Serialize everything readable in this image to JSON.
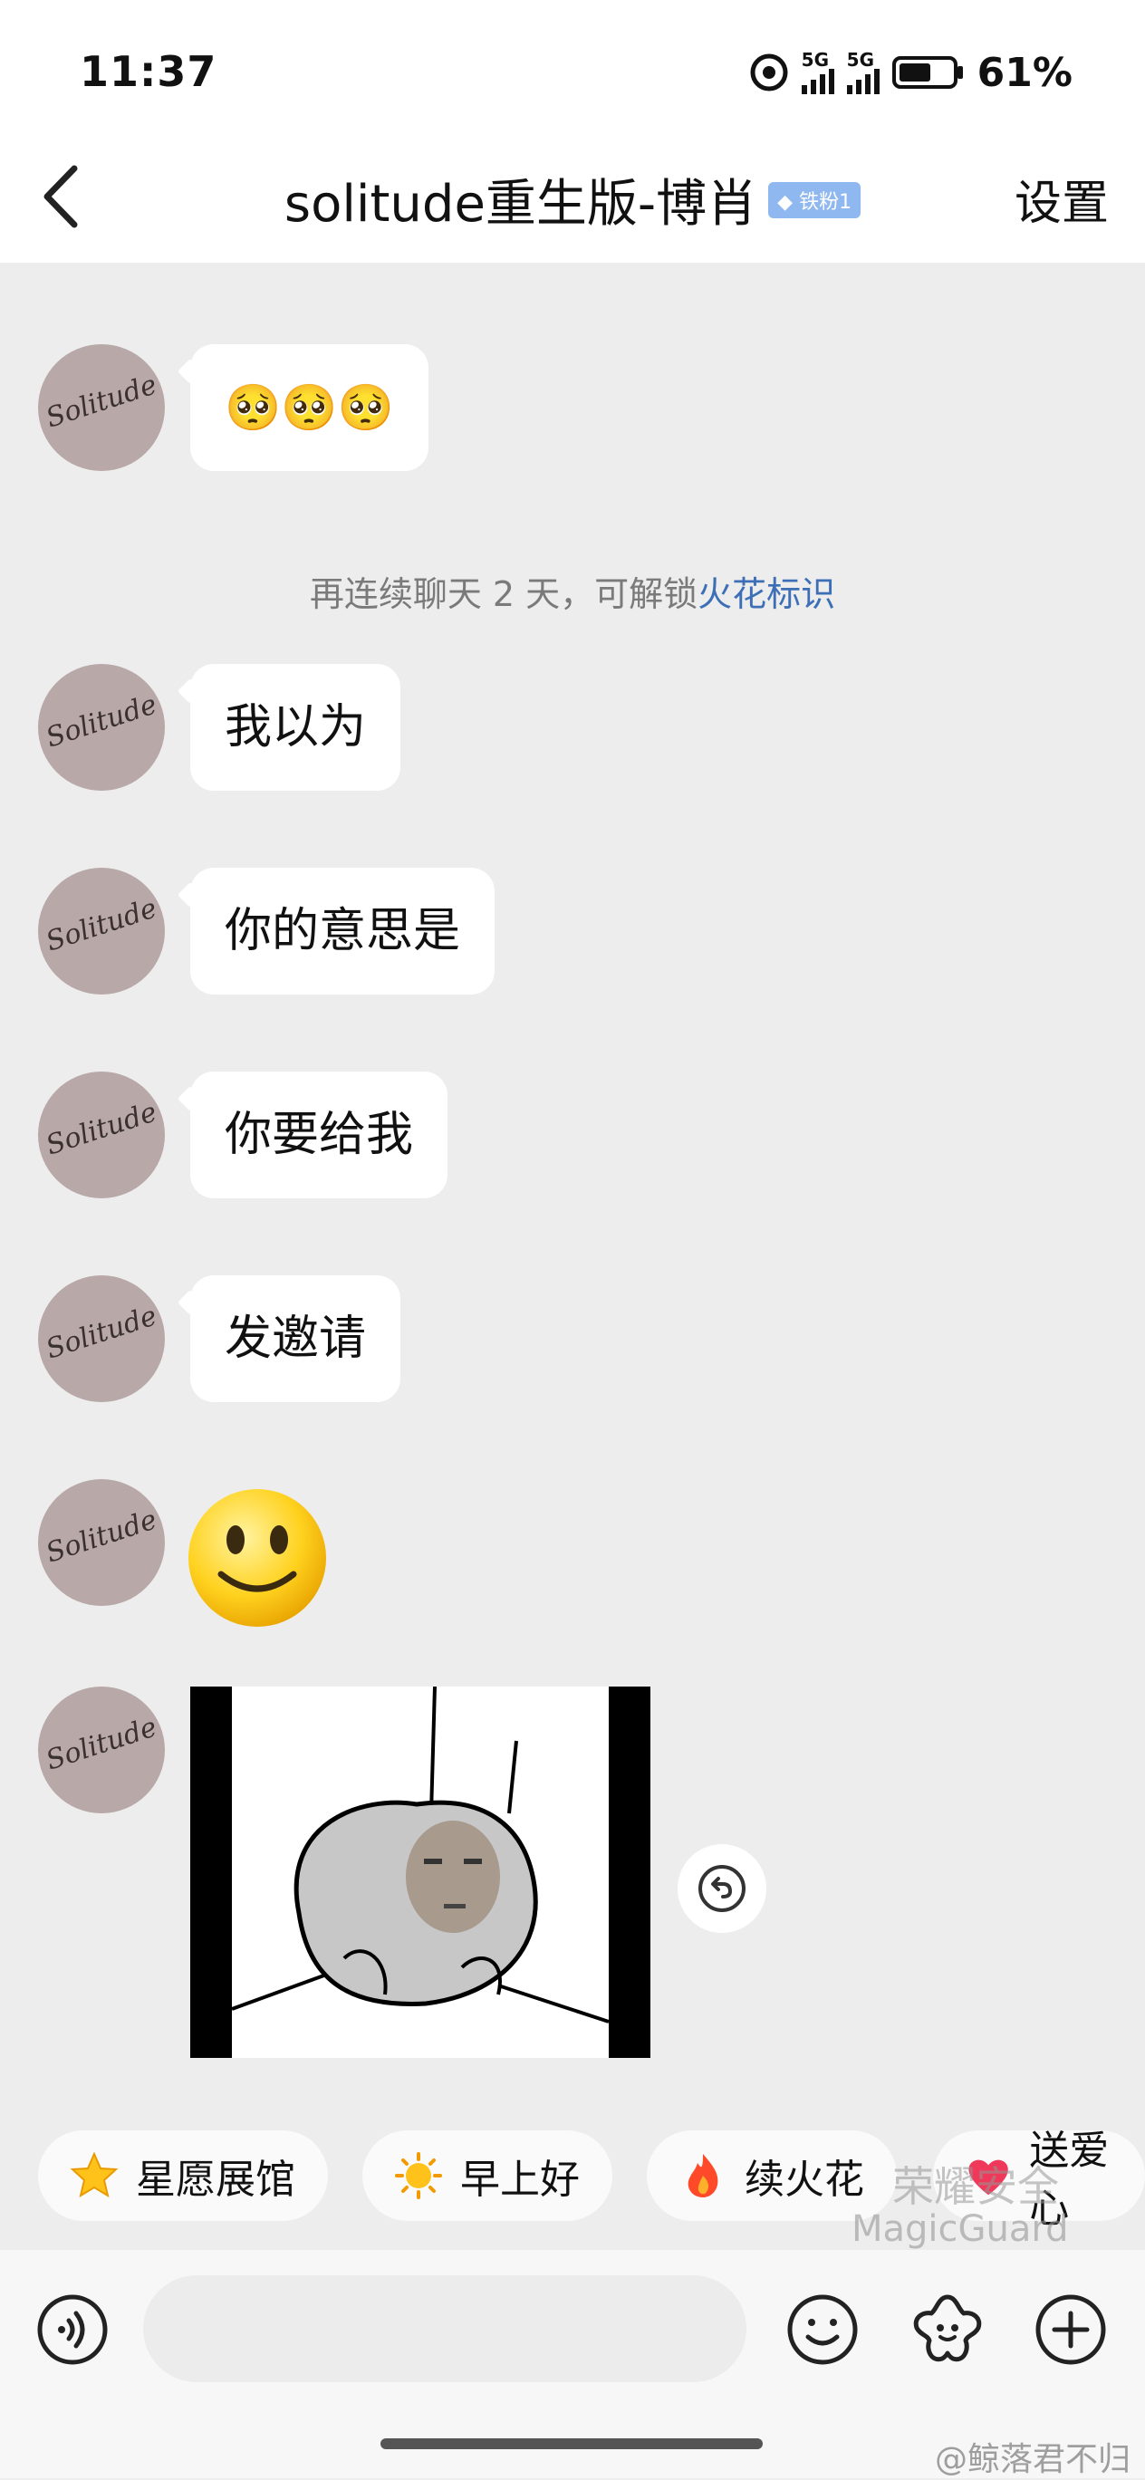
{
  "status_bar": {
    "time": "11:37",
    "network1": "5G",
    "network2": "5G",
    "battery_percent": "61%",
    "battery_level": 0.61
  },
  "nav": {
    "back_icon": "chevron-left-icon",
    "title": "solitude重生版-博肖",
    "badge": "铁粉1",
    "settings": "设置"
  },
  "messages": {
    "m0": {
      "emoji_text": "🥺🥺🥺"
    },
    "notice": {
      "text": "再连续聊天 2 天，可解锁",
      "link": "火花标识"
    },
    "m1": {
      "text": "我以为"
    },
    "m2": {
      "text": "你的意思是"
    },
    "m3": {
      "text": "你要给我"
    },
    "m4": {
      "text": "发邀请"
    },
    "m5": {
      "emoji": "smiley-face"
    },
    "m6": {
      "sticker": "meme-sticker-with-face"
    }
  },
  "avatar": {
    "signature": "Solitude"
  },
  "quick_replies": {
    "r1": {
      "icon": "star-icon",
      "label": "星愿展馆"
    },
    "r2": {
      "icon": "sun-icon",
      "label": "早上好"
    },
    "r3": {
      "icon": "fire-icon",
      "label": "续火花"
    },
    "r4": {
      "icon": "heart-icon",
      "label": "送爱心"
    }
  },
  "watermarks": {
    "brand_cn": "荣耀安全",
    "brand_en": "MagicGuard",
    "weibo": "@鲸落君不归"
  },
  "toolbar": {
    "voice_icon": "voice-icon",
    "emoji_icon": "emoji-icon",
    "sticker_icon": "flower-icon",
    "plus_icon": "plus-icon"
  }
}
